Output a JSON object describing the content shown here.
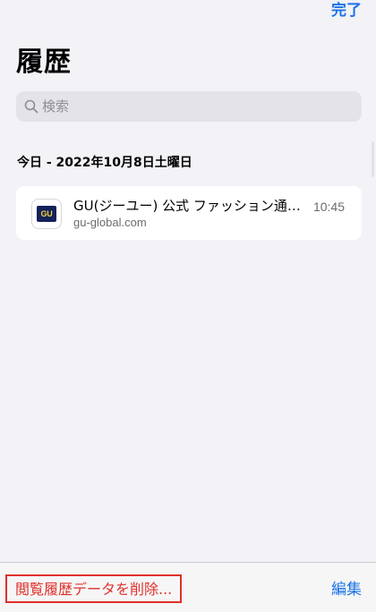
{
  "header": {
    "done_label": "完了",
    "title": "履歴"
  },
  "search": {
    "placeholder": "検索"
  },
  "section": {
    "header": "今日 - 2022年10月8日土曜日"
  },
  "history_items": [
    {
      "title": "GU(ジーユー) 公式 ファッション通…",
      "url": "gu-global.com",
      "time": "10:45",
      "favicon_text": "GU",
      "favicon_bg": "#14215a",
      "favicon_fg": "#f0d43a"
    }
  ],
  "toolbar": {
    "clear_label": "閲覧履歴データを削除...",
    "edit_label": "編集"
  },
  "colors": {
    "accent": "#1a73e8",
    "destructive": "#e0302a",
    "background": "#f2f2f7"
  },
  "icons": {
    "search": "search-icon",
    "favicon": "gu-favicon-icon"
  }
}
